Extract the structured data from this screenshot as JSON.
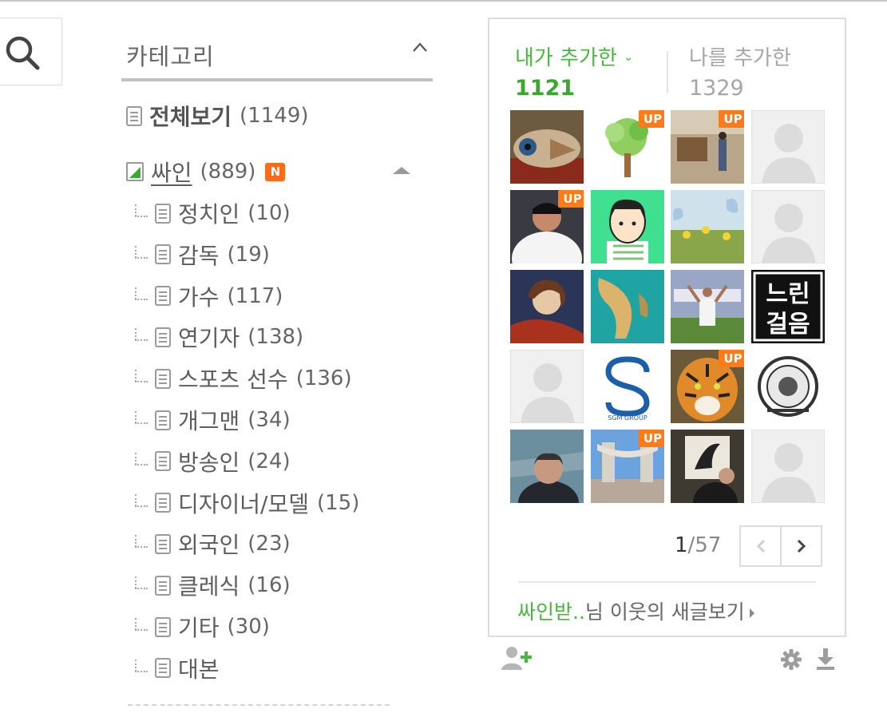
{
  "category": {
    "title": "카테고리",
    "all": {
      "label": "전체보기",
      "count": "(1149)"
    },
    "folder": {
      "label": "싸인",
      "count": "(889)",
      "new_badge": "N"
    },
    "items": [
      {
        "label": "정치인",
        "count": "(10)"
      },
      {
        "label": "감독",
        "count": "(19)"
      },
      {
        "label": "가수",
        "count": "(117)"
      },
      {
        "label": "연기자",
        "count": "(138)"
      },
      {
        "label": "스포츠 선수",
        "count": "(136)"
      },
      {
        "label": "개그맨",
        "count": "(34)"
      },
      {
        "label": "방송인",
        "count": "(24)"
      },
      {
        "label": "디자이너/모델",
        "count": "(15)"
      },
      {
        "label": "외국인",
        "count": "(23)"
      },
      {
        "label": "클레식",
        "count": "(16)"
      },
      {
        "label": "기타",
        "count": "(30)"
      },
      {
        "label": "대본",
        "count": ""
      }
    ]
  },
  "neighbors": {
    "tab_mine": {
      "label": "내가 추가한",
      "count": "1121"
    },
    "tab_them": {
      "label": "나를 추가한",
      "count": "1329"
    },
    "up_badge": "UP",
    "thumbnails": [
      {
        "name": "thumb-painted-boat",
        "up": false
      },
      {
        "name": "thumb-green-tree",
        "up": true
      },
      {
        "name": "thumb-room-person",
        "up": true
      },
      {
        "name": "thumb-default-profile",
        "up": false
      },
      {
        "name": "thumb-baseball-player",
        "up": true
      },
      {
        "name": "thumb-cartoon-boy",
        "up": false
      },
      {
        "name": "thumb-butterfly-flowers",
        "up": false
      },
      {
        "name": "thumb-default-profile",
        "up": false
      },
      {
        "name": "thumb-painting-woman",
        "up": false
      },
      {
        "name": "thumb-relief-map",
        "up": false
      },
      {
        "name": "thumb-marathon-runner",
        "up": false
      },
      {
        "name": "thumb-slow-walk-logo",
        "up": false
      },
      {
        "name": "thumb-default-profile",
        "up": false
      },
      {
        "name": "thumb-sgm-group-logo",
        "up": false
      },
      {
        "name": "thumb-tiger",
        "up": true
      },
      {
        "name": "thumb-lion-emblem",
        "up": false
      },
      {
        "name": "thumb-man-portrait",
        "up": false
      },
      {
        "name": "thumb-stadium-gate",
        "up": true
      },
      {
        "name": "thumb-artist-painting",
        "up": false
      },
      {
        "name": "thumb-default-profile",
        "up": false
      }
    ],
    "logo_text": {
      "slow_walk": [
        "느린",
        "걸음"
      ],
      "sgm": "SGM GROUP"
    },
    "pager": {
      "current": "1",
      "total": "/57"
    },
    "footer_link": {
      "name_part": "싸인받..",
      "rest": "님 이웃의 새글보기"
    }
  },
  "colors": {
    "accent_green": "#4bb540",
    "badge_orange": "#ff7b1a",
    "divider": "#c9bdbd"
  }
}
